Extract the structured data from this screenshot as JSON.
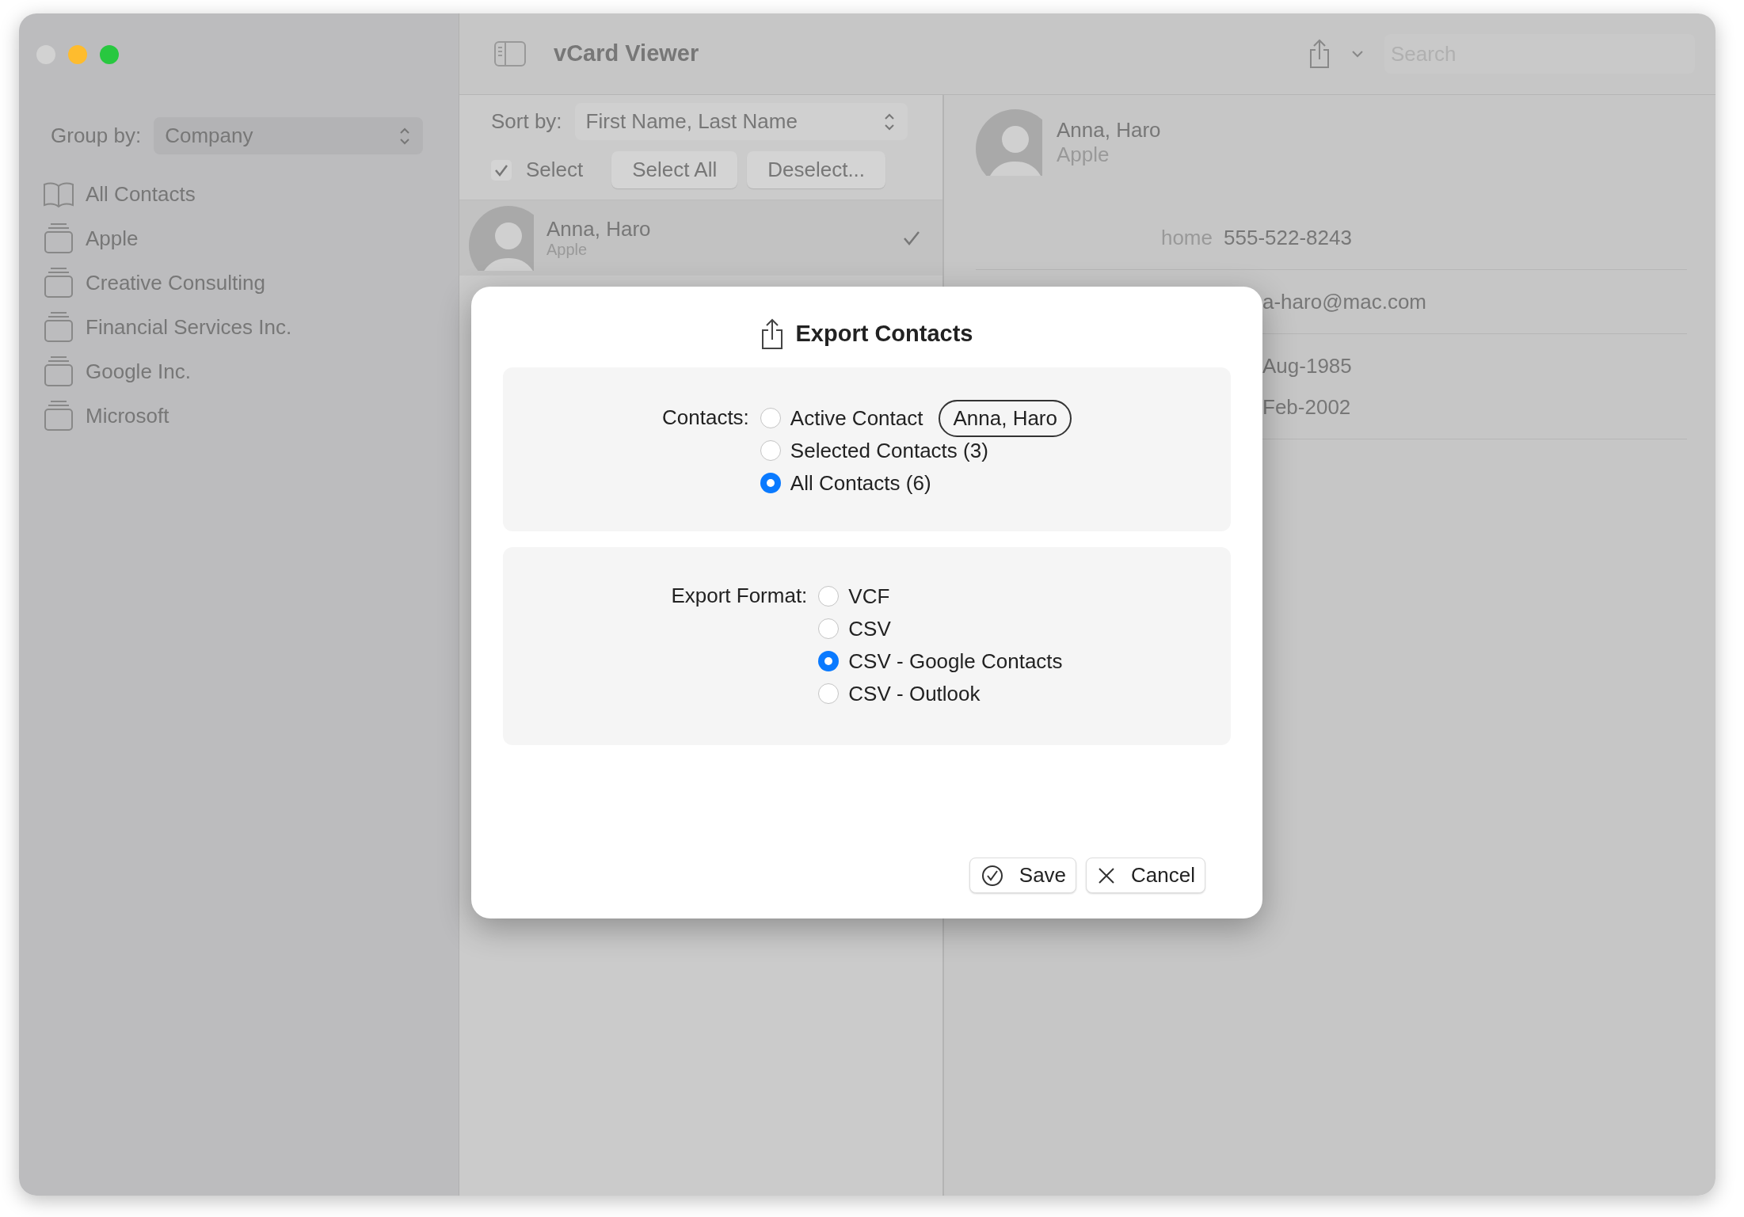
{
  "window": {
    "title": "vCard Viewer"
  },
  "sidebar": {
    "group_by": {
      "label": "Group by:",
      "value": "Company"
    },
    "items": [
      {
        "label": "All Contacts",
        "kind": "all"
      },
      {
        "label": "Apple",
        "kind": "group"
      },
      {
        "label": "Creative Consulting",
        "kind": "group"
      },
      {
        "label": "Financial Services Inc.",
        "kind": "group"
      },
      {
        "label": "Google Inc.",
        "kind": "group"
      },
      {
        "label": "Microsoft",
        "kind": "group"
      }
    ]
  },
  "toolbar": {
    "search": {
      "placeholder": "Search"
    }
  },
  "list": {
    "sort_by": {
      "label": "Sort by:",
      "value": "First Name, Last Name"
    },
    "select": {
      "label": "Select",
      "checked": true
    },
    "buttons": [
      "Select All",
      "Deselect..."
    ],
    "contacts": [
      {
        "name": "Anna, Haro",
        "company": "Apple",
        "checked": true
      }
    ]
  },
  "detail": {
    "name": "Anna, Haro",
    "company": "Apple",
    "field_groups": [
      [
        {
          "kind": "labeled",
          "label": "home",
          "value": "555-522-8243"
        }
      ],
      [
        {
          "kind": "covered",
          "value": "a-haro@mac.com"
        }
      ],
      [
        {
          "kind": "covered",
          "value": "Aug-1985"
        },
        {
          "kind": "covered",
          "value": "Feb-2002"
        }
      ]
    ]
  },
  "dialog": {
    "title": "Export Contacts",
    "sections": [
      {
        "label": "Contacts:",
        "options": [
          {
            "label": "Active Contact",
            "selected": false,
            "tag": "Anna, Haro"
          },
          {
            "label": "Selected Contacts (3)",
            "selected": false
          },
          {
            "label": "All Contacts (6)",
            "selected": true
          }
        ]
      },
      {
        "label": "Export Format:",
        "options": [
          {
            "label": "VCF",
            "selected": false
          },
          {
            "label": "CSV",
            "selected": false
          },
          {
            "label": "CSV - Google Contacts",
            "selected": true
          },
          {
            "label": "CSV - Outlook",
            "selected": false
          }
        ]
      }
    ],
    "buttons": [
      {
        "label": "Save",
        "kind": "save"
      },
      {
        "label": "Cancel",
        "kind": "cancel"
      }
    ]
  }
}
